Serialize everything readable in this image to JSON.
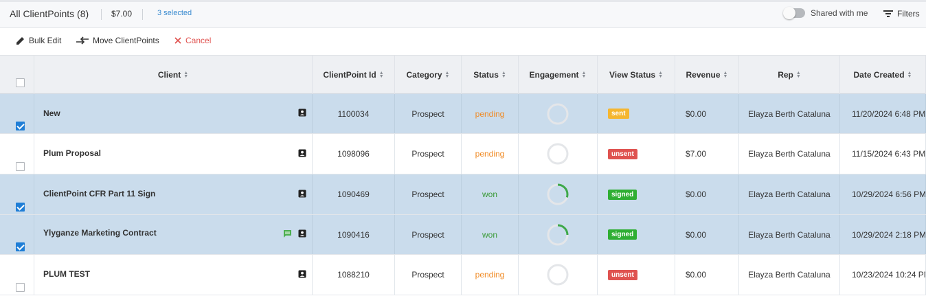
{
  "topbar": {
    "title": "All ClientPoints (8)",
    "total": "$7.00",
    "selected": "3 selected",
    "shared_label": "Shared with me",
    "filters_label": "Filters"
  },
  "toolbar": {
    "bulk_edit": "Bulk Edit",
    "move": "Move ClientPoints",
    "cancel": "Cancel"
  },
  "columns": [
    "Client",
    "ClientPoint Id",
    "Category",
    "Status",
    "Engagement",
    "View Status",
    "Revenue",
    "Rep",
    "Date Created"
  ],
  "rows": [
    {
      "selected": true,
      "client": "New",
      "id": "1100034",
      "category": "Prospect",
      "status": "pending",
      "engagement": 0.0,
      "view_status": "sent",
      "revenue": "$0.00",
      "rep": "Elayza Berth Cataluna",
      "date": "11/20/2024 6:48 PM",
      "has_comment": false
    },
    {
      "selected": false,
      "client": "Plum Proposal",
      "id": "1098096",
      "category": "Prospect",
      "status": "pending",
      "engagement": 0.0,
      "view_status": "unsent",
      "revenue": "$7.00",
      "rep": "Elayza Berth Cataluna",
      "date": "11/15/2024 6:43 PM",
      "has_comment": false
    },
    {
      "selected": true,
      "client": "ClientPoint CFR Part 11 Sign",
      "id": "1090469",
      "category": "Prospect",
      "status": "won",
      "engagement": 0.3,
      "view_status": "signed",
      "revenue": "$0.00",
      "rep": "Elayza Berth Cataluna",
      "date": "10/29/2024 6:56 PM",
      "has_comment": false
    },
    {
      "selected": true,
      "client": "Ylyganze Marketing Contract",
      "id": "1090416",
      "category": "Prospect",
      "status": "won",
      "engagement": 0.25,
      "view_status": "signed",
      "revenue": "$0.00",
      "rep": "Elayza Berth Cataluna",
      "date": "10/29/2024 2:18 PM",
      "has_comment": true
    },
    {
      "selected": false,
      "client": "PLUM TEST",
      "id": "1088210",
      "category": "Prospect",
      "status": "pending",
      "engagement": 0.0,
      "view_status": "unsent",
      "revenue": "$0.00",
      "rep": "Elayza Berth Cataluna",
      "date": "10/23/2024 10:24 PM",
      "has_comment": false
    }
  ],
  "colors": {
    "sent": "#f5b630",
    "unsent": "#df5350",
    "signed": "#2fae33",
    "pending": "#f08a24",
    "won": "#3a9a37",
    "selected_row": "#cadcec",
    "checkbox": "#1f7ed6",
    "link": "#3a8bd0"
  },
  "icons": {
    "edit": "pencil-icon",
    "move": "move-arrows-icon",
    "cancel": "close-icon",
    "filters": "filter-icon",
    "contact": "contact-card-icon",
    "comment": "comment-icon"
  }
}
